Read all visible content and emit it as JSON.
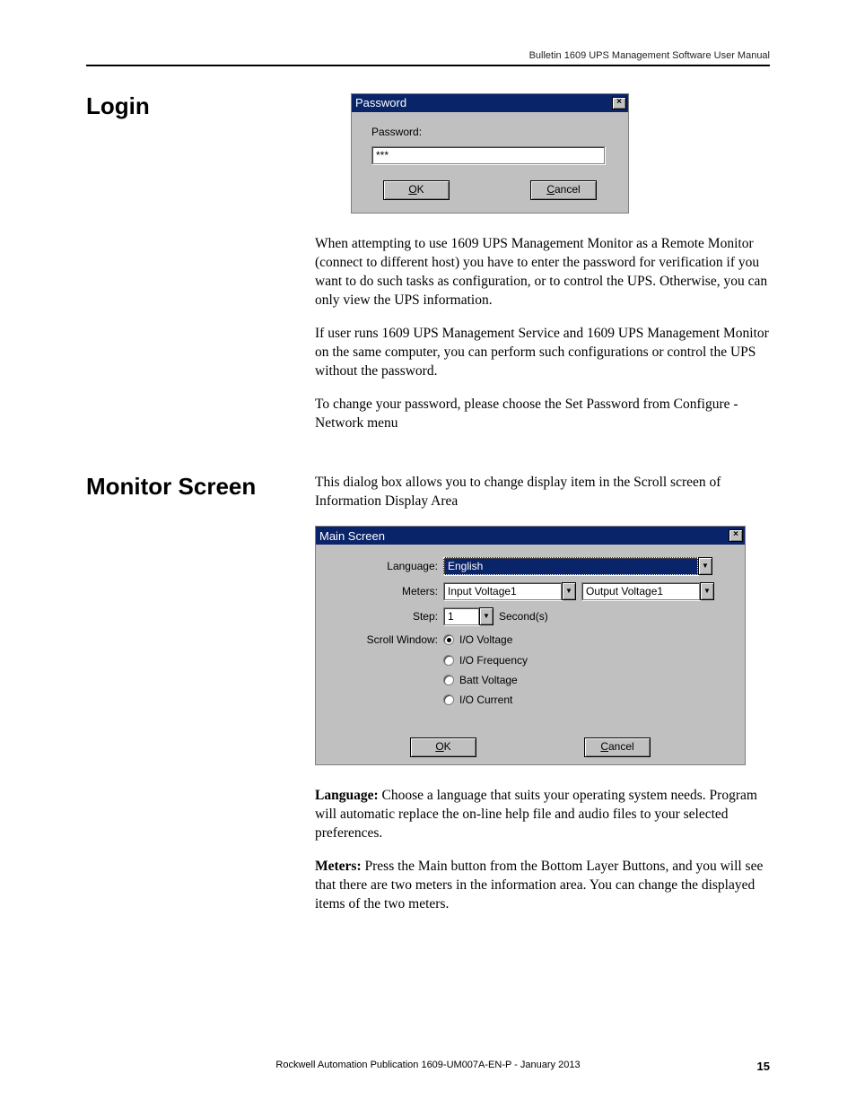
{
  "header": {
    "running": "Bulletin 1609 UPS Management Software User Manual"
  },
  "login": {
    "heading": "Login",
    "dialog": {
      "title": "Password",
      "password_label": "Password:",
      "password_value": "***",
      "ok_prefix": "O",
      "ok_rest": "K",
      "cancel_prefix": "C",
      "cancel_rest": "ancel"
    },
    "para1": "When attempting to use 1609 UPS Management Monitor as a Remote Monitor (connect to different host) you have to enter the password for verification if you want to do such tasks as configuration, or to control the UPS. Otherwise, you can only view the UPS information.",
    "para2": "If user runs 1609 UPS Management Service and 1609 UPS Management Monitor on the same computer, you can perform such configurations or control the UPS without the password.",
    "para3": "To change your password, please choose the Set Password from Configure - Network menu"
  },
  "monitor": {
    "heading": "Monitor Screen",
    "intro": "This dialog box allows you to change display item in the Scroll screen of Information Display Area",
    "dialog": {
      "title": "Main Screen",
      "labels": {
        "language": "Language:",
        "meters": "Meters:",
        "step": "Step:",
        "scroll_window": "Scroll Window:",
        "seconds": "Second(s)"
      },
      "values": {
        "language": "English",
        "meter1": "Input Voltage1",
        "meter2": "Output Voltage1",
        "step": "1"
      },
      "radios": {
        "io_voltage": "I/O Voltage",
        "io_frequency": "I/O Frequency",
        "batt_voltage": "Batt Voltage",
        "io_current": "I/O Current",
        "selected": "io_voltage"
      },
      "ok_prefix": "O",
      "ok_rest": "K",
      "cancel_prefix": "C",
      "cancel_rest": "ancel"
    },
    "lang_bold": "Language:",
    "lang_text": " Choose a language that suits your operating system needs. Program will automatic replace the on-line help file and audio files to your selected preferences.",
    "meters_bold": "Meters:",
    "meters_text": " Press the Main button from the Bottom Layer Buttons, and you will see that there are two meters in the information area. You can change the displayed items of the two meters."
  },
  "footer": {
    "publication": "Rockwell Automation Publication 1609-UM007A-EN-P - January 2013",
    "page": "15"
  }
}
